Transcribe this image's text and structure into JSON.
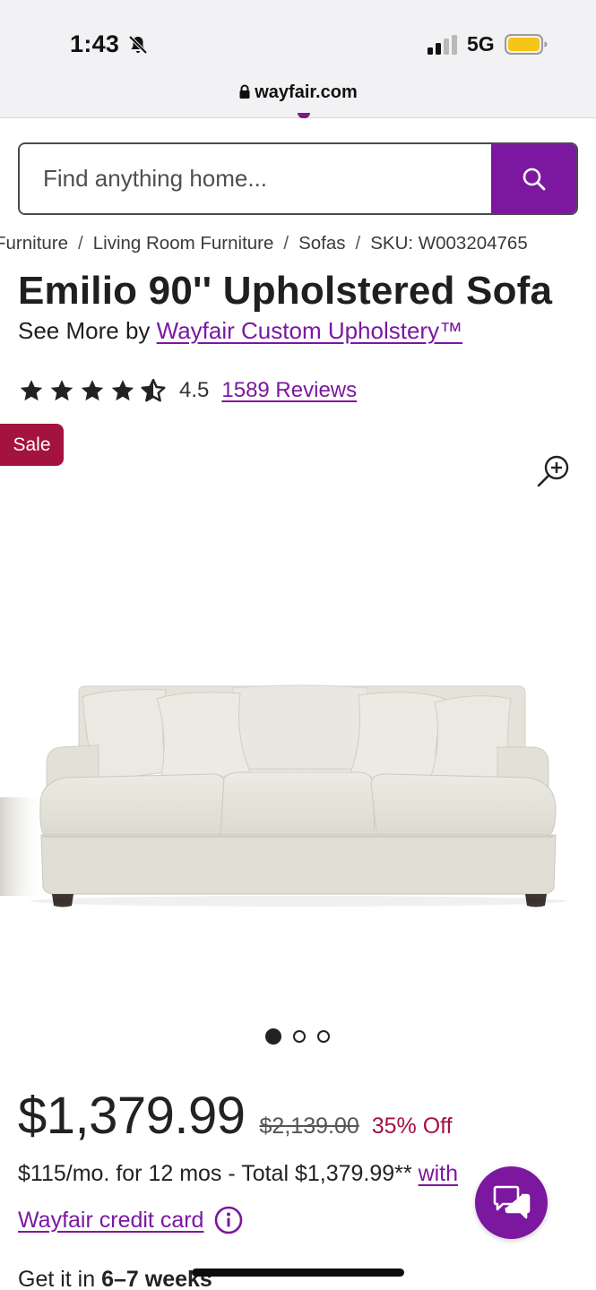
{
  "status_bar": {
    "time": "1:43",
    "network": "5G",
    "battery_color": "#f5c518",
    "url": "wayfair.com"
  },
  "search": {
    "placeholder": "Find anything home..."
  },
  "breadcrumb": {
    "items": [
      "Furniture",
      "Living Room Furniture",
      "Sofas"
    ],
    "separator": "/",
    "sku": "SKU: W003204765"
  },
  "product": {
    "title": "Emilio 90'' Upholstered Sofa",
    "see_more_prefix": "See More by ",
    "brand": "Wayfair Custom Upholstery™",
    "rating": "4.5",
    "rating_value": 4.5,
    "rating_max": 5,
    "reviews": "1589 Reviews",
    "badge": "Sale",
    "gallery_count": 3,
    "gallery_active": 1
  },
  "pricing": {
    "price": "$1,379.99",
    "old_price": "$2,139.00",
    "discount": "35% Off",
    "financing_text": "$115/mo. for 12 mos - Total $1,379.99** ",
    "financing_link": "with",
    "credit_card_link": "Wayfair credit card"
  },
  "delivery": {
    "prefix": "Get it in ",
    "weeks": "6–7 weeks"
  },
  "colors": {
    "brand_purple": "#7b189f",
    "sale_red": "#a4123f"
  }
}
